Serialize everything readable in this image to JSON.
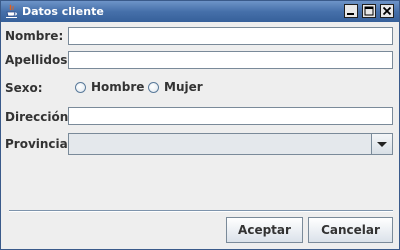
{
  "window": {
    "title": "Datos cliente",
    "icons": [
      "java-cup-icon",
      "minimize-icon",
      "maximize-icon",
      "close-icon"
    ]
  },
  "form": {
    "nombre_label": "Nombre:",
    "nombre_value": "",
    "apellidos_label": "Apellidos:",
    "apellidos_value": "",
    "sexo_label": "Sexo:",
    "sexo_options": [
      "Hombre",
      "Mujer"
    ],
    "direccion_label": "Dirección:",
    "direccion_value": "",
    "provincia_label": "Provincia:",
    "provincia_value": ""
  },
  "buttons": {
    "accept_label": "Aceptar",
    "cancel_label": "Cancelar"
  },
  "colors": {
    "titlebar": "#4670aa",
    "background": "#eeeeee",
    "field_border": "#7a8a99"
  }
}
